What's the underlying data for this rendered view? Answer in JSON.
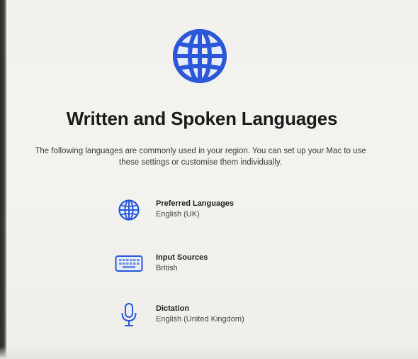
{
  "colors": {
    "accent": "#2b56d6",
    "background": "#f2f1ed"
  },
  "hero": {
    "icon": "globe-icon",
    "title": "Written and Spoken Languages",
    "description": "The following languages are commonly used in your region. You can set up your Mac to use these settings or customise them individually."
  },
  "settings": [
    {
      "icon": "globe-icon",
      "label": "Preferred Languages",
      "value": "English (UK)"
    },
    {
      "icon": "keyboard-icon",
      "label": "Input Sources",
      "value": "British"
    },
    {
      "icon": "microphone-icon",
      "label": "Dictation",
      "value": "English (United Kingdom)"
    }
  ]
}
